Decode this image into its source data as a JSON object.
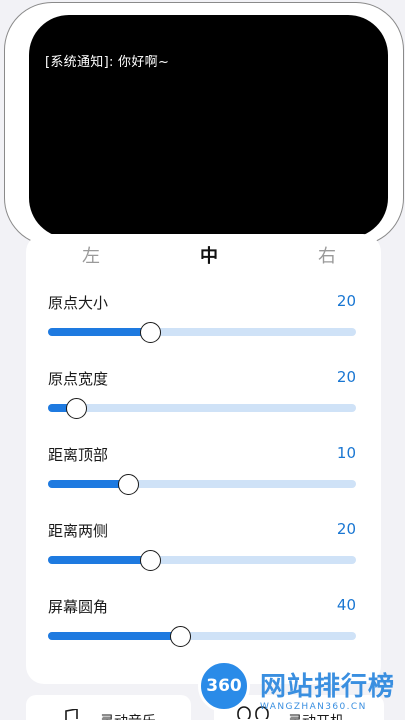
{
  "preview": {
    "notify_text": "[系统通知]: 你好啊~"
  },
  "alignment": {
    "left": "左",
    "center": "中",
    "right": "右",
    "selected": "中"
  },
  "sliders": [
    {
      "label": "原点大小",
      "value": "20",
      "fraction": 0.33
    },
    {
      "label": "原点宽度",
      "value": "20",
      "fraction": 0.09
    },
    {
      "label": "距离顶部",
      "value": "10",
      "fraction": 0.26
    },
    {
      "label": "距离两侧",
      "value": "20",
      "fraction": 0.33
    },
    {
      "label": "屏幕圆角",
      "value": "40",
      "fraction": 0.43
    }
  ],
  "actions": {
    "music_label": "灵动音乐",
    "boot_label": "灵动开机"
  },
  "watermark": {
    "logo_text": "360",
    "title": "网站排行榜",
    "subtitle": "WANGZHAN360.CN"
  },
  "colors": {
    "accent": "#1e7ae0",
    "track": "#cfe2f7",
    "value_text": "#1976d2"
  }
}
